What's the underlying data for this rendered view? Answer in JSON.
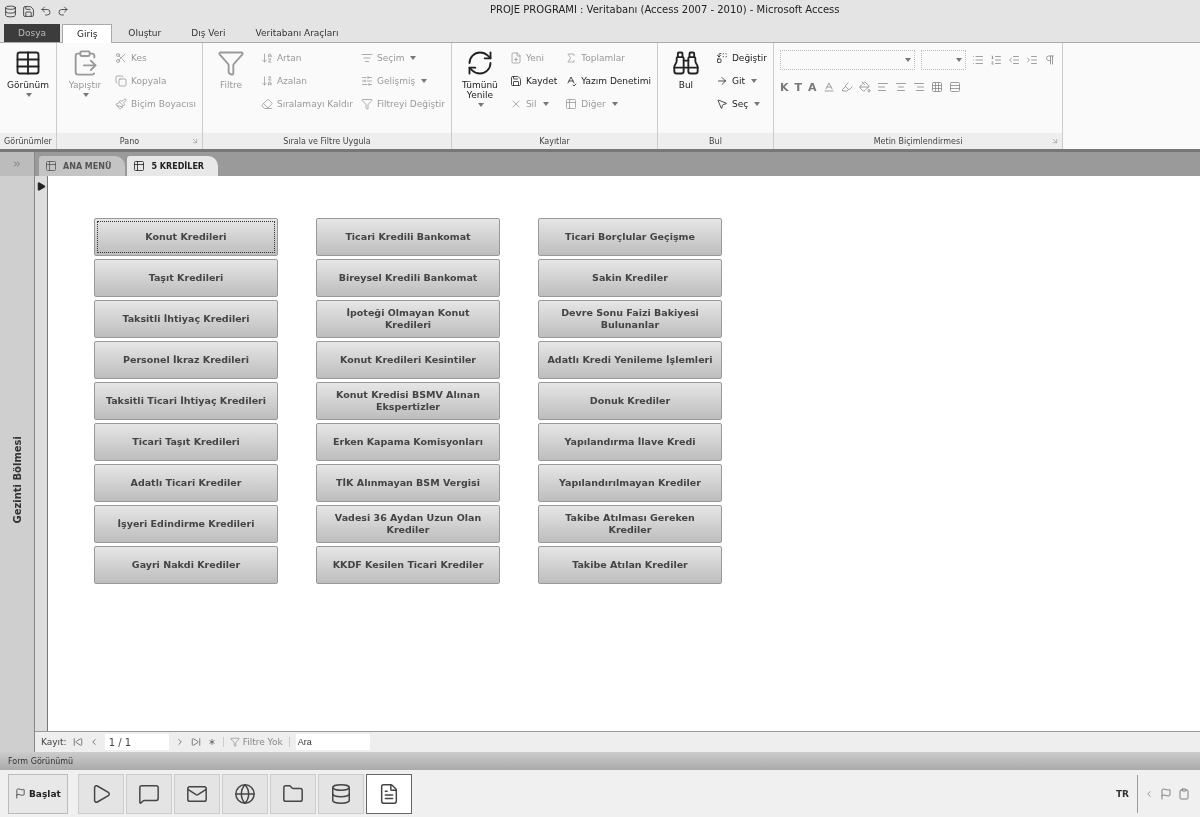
{
  "window": {
    "title": "PROJE PROGRAMI : Veritabanı (Access 2007 - 2010)  -  Microsoft Access"
  },
  "ribbon_tabs": [
    {
      "kind": "file",
      "label": "Dosya",
      "selected": false
    },
    {
      "kind": "tab",
      "label": "Giriş",
      "selected": true
    },
    {
      "kind": "tab",
      "label": "Oluştur",
      "selected": false
    },
    {
      "kind": "tab",
      "label": "Dış Veri",
      "selected": false
    },
    {
      "kind": "tab",
      "label": "Veritabanı Araçları",
      "selected": false
    }
  ],
  "ribbon_groups": [
    {
      "kind": "commands",
      "label": "Görünümler",
      "launcher": false,
      "items": [
        {
          "kind": "large",
          "label": "Görünüm",
          "disabled": false,
          "dropdown": true
        }
      ]
    },
    {
      "kind": "commands",
      "label": "Pano",
      "launcher": true,
      "items": [
        {
          "kind": "large",
          "label": "Yapıştır",
          "disabled": true,
          "dropdown": true
        },
        {
          "kind": "small",
          "label": "Kes",
          "disabled": true,
          "dropdown": false
        },
        {
          "kind": "small",
          "label": "Kopyala",
          "disabled": true,
          "dropdown": false
        },
        {
          "kind": "small",
          "label": "Biçim Boyacısı",
          "disabled": true,
          "dropdown": false
        }
      ]
    },
    {
      "kind": "commands",
      "label": "Sırala ve Filtre Uygula",
      "launcher": false,
      "items": [
        {
          "kind": "large",
          "label": "Filtre",
          "disabled": true,
          "dropdown": false
        },
        {
          "kind": "small",
          "label": "Artan",
          "disabled": true,
          "dropdown": false
        },
        {
          "kind": "small",
          "label": "Azalan",
          "disabled": true,
          "dropdown": false
        },
        {
          "kind": "small",
          "label": "Sıralamayı Kaldır",
          "disabled": true,
          "dropdown": false
        },
        {
          "kind": "small",
          "label": "Seçim",
          "disabled": true,
          "dropdown": true
        },
        {
          "kind": "small",
          "label": "Gelişmiş",
          "disabled": true,
          "dropdown": true
        },
        {
          "kind": "small",
          "label": "Filtreyi Değiştir",
          "disabled": true,
          "dropdown": false
        }
      ]
    },
    {
      "kind": "commands",
      "label": "Kayıtlar",
      "launcher": false,
      "items": [
        {
          "kind": "large",
          "label": "Tümünü Yenile",
          "disabled": false,
          "dropdown": true
        },
        {
          "kind": "small",
          "label": "Yeni",
          "disabled": true,
          "dropdown": false
        },
        {
          "kind": "small",
          "label": "Kaydet",
          "disabled": false,
          "dropdown": false
        },
        {
          "kind": "small",
          "label": "Sil",
          "disabled": true,
          "dropdown": true
        },
        {
          "kind": "small",
          "label": "Toplamlar",
          "disabled": true,
          "dropdown": false
        },
        {
          "kind": "small",
          "label": "Yazım Denetimi",
          "disabled": false,
          "dropdown": false
        },
        {
          "kind": "small",
          "label": "Diğer",
          "disabled": true,
          "dropdown": true
        }
      ]
    },
    {
      "kind": "commands",
      "label": "Bul",
      "launcher": false,
      "items": [
        {
          "kind": "large",
          "label": "Bul",
          "disabled": false,
          "dropdown": false
        },
        {
          "kind": "small",
          "label": "Değiştir",
          "disabled": false,
          "dropdown": false
        },
        {
          "kind": "small",
          "label": "Git",
          "disabled": false,
          "dropdown": true
        },
        {
          "kind": "small",
          "label": "Seç",
          "disabled": false,
          "dropdown": true
        }
      ]
    },
    {
      "kind": "text-format",
      "label": "Metin Biçimlendirmesi",
      "launcher": true,
      "format_letters": [
        "K",
        "T",
        "A"
      ]
    }
  ],
  "document_tabs": [
    {
      "label": "ANA MENÜ",
      "selected": false
    },
    {
      "label": "5 KREDİLER",
      "selected": true
    }
  ],
  "navigation_pane": {
    "label": "Gezinti Bölmesi"
  },
  "form_buttons": [
    [
      {
        "label": "Konut Kredileri",
        "selected": true
      },
      {
        "label": "Taşıt Kredileri",
        "selected": false
      },
      {
        "label": "Taksitli İhtiyaç Kredileri",
        "selected": false
      },
      {
        "label": "Personel İkraz Kredileri",
        "selected": false
      },
      {
        "label": "Taksitli Ticari İhtiyaç Kredileri",
        "selected": false
      },
      {
        "label": "Ticari Taşıt Kredileri",
        "selected": false
      },
      {
        "label": "Adatlı Ticari Krediler",
        "selected": false
      },
      {
        "label": "İşyeri Edindirme Kredileri",
        "selected": false
      },
      {
        "label": "Gayri Nakdi Krediler",
        "selected": false
      }
    ],
    [
      {
        "label": "Ticari Kredili Bankomat",
        "selected": false
      },
      {
        "label": "Bireysel Kredili Bankomat",
        "selected": false
      },
      {
        "label": "İpoteği Olmayan Konut Kredileri",
        "selected": false
      },
      {
        "label": "Konut Kredileri Kesintiler",
        "selected": false
      },
      {
        "label": "Konut Kredisi BSMV Alınan Ekspertizler",
        "selected": false
      },
      {
        "label": "Erken Kapama Komisyonları",
        "selected": false
      },
      {
        "label": "TİK Alınmayan BSM Vergisi",
        "selected": false
      },
      {
        "label": "Vadesi 36 Aydan Uzun Olan Krediler",
        "selected": false
      },
      {
        "label": "KKDF Kesilen Ticari Krediler",
        "selected": false
      }
    ],
    [
      {
        "label": "Ticari Borçlular Geçişme",
        "selected": false
      },
      {
        "label": "Sakin Krediler",
        "selected": false
      },
      {
        "label": "Devre Sonu Faizi Bakiyesi Bulunanlar",
        "selected": false
      },
      {
        "label": "Adatlı Kredi Yenileme İşlemleri",
        "selected": false
      },
      {
        "label": "Donuk Krediler",
        "selected": false
      },
      {
        "label": "Yapılandırma İlave Kredi",
        "selected": false
      },
      {
        "label": "Yapılandırılmayan Krediler",
        "selected": false
      },
      {
        "label": "Takibe Atılması Gereken Krediler",
        "selected": false
      },
      {
        "label": "Takibe Atılan Krediler",
        "selected": false
      }
    ]
  ],
  "record_navigator": {
    "label": "Kayıt:",
    "position": "1 / 1",
    "filter": "Filtre Yok",
    "search": {
      "placeholder": "Ara"
    }
  },
  "status_bar": {
    "text": "Form Görünümü"
  },
  "taskbar": {
    "start": "Başlat",
    "apps": [
      {
        "selected": false
      },
      {
        "selected": false
      },
      {
        "selected": false
      },
      {
        "selected": false
      },
      {
        "selected": false
      },
      {
        "selected": false
      },
      {
        "selected": true
      }
    ],
    "language": "TR"
  }
}
